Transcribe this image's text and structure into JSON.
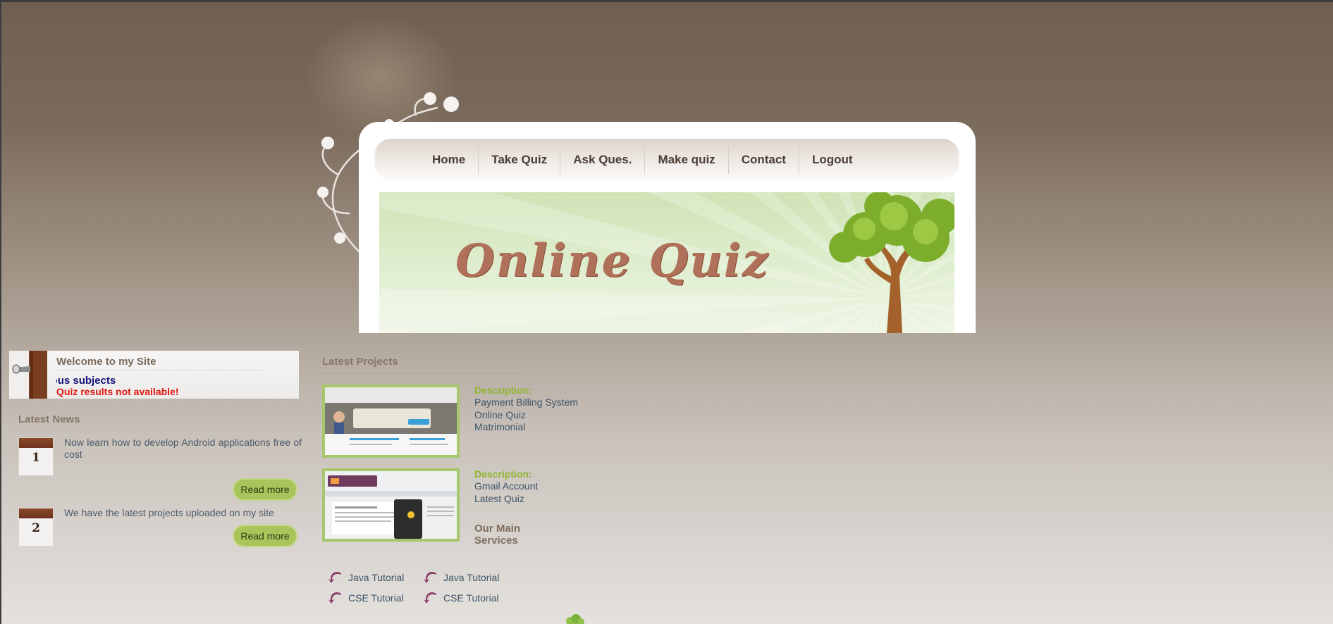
{
  "nav": {
    "items": [
      "Home",
      "Take Quiz",
      "Ask Ques.",
      "Make quiz",
      "Contact",
      "Logout"
    ]
  },
  "banner": {
    "title": "Online Quiz"
  },
  "welcome": {
    "title": "Welcome to my Site",
    "marquee_text": "Try taking quizzes on various subjects",
    "quiz_result": "Quiz results not available!"
  },
  "latest_news": {
    "heading": "Latest News",
    "items": [
      {
        "number": "1",
        "text": "Now learn how to develop Android applications free of cost",
        "read_more": "Read more"
      },
      {
        "number": "2",
        "text": "We have the latest projects uploaded on my site",
        "read_more": "Read more"
      }
    ]
  },
  "latest_projects": {
    "heading": "Latest Projects",
    "projects": [
      {
        "description_label": "Description:",
        "links": [
          "Payment Billing System",
          "Online Quiz",
          "Matrimonial"
        ]
      },
      {
        "description_label": "Description:",
        "links": [
          "Gmail Account",
          "Latest Quiz"
        ]
      }
    ]
  },
  "services": {
    "heading": "Our Main Services",
    "tutorials": [
      "Java Tutorial",
      "Java Tutorial",
      "CSE Tutorial",
      "CSE Tutorial"
    ]
  },
  "colors": {
    "nav_text": "#4a3d35",
    "banner_title": "#b0715a",
    "marquee_text": "#14157a",
    "quiz_result": "#e0140f",
    "description_label": "#8fb531",
    "read_more_button": "#a8c45a",
    "link_text": "#3e5467"
  },
  "icons": [
    "flourish-ornament",
    "tree-illustration",
    "door-handle-icon",
    "arrow-curl-icon",
    "leaf-icon"
  ]
}
